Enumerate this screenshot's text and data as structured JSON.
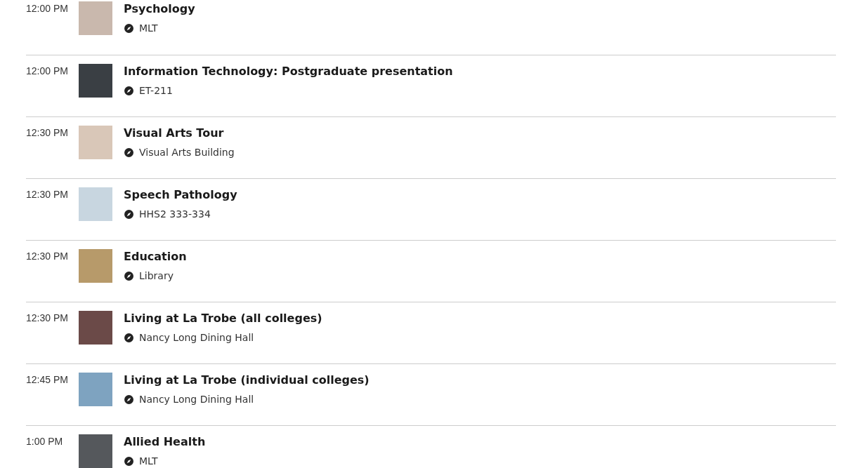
{
  "events": [
    {
      "time": "12:00 PM",
      "title": "Psychology",
      "location": "MLT"
    },
    {
      "time": "12:00 PM",
      "title": "Information Technology: Postgraduate presentation",
      "location": "ET-211"
    },
    {
      "time": "12:30 PM",
      "title": "Visual Arts Tour",
      "location": "Visual Arts Building"
    },
    {
      "time": "12:30 PM",
      "title": "Speech Pathology",
      "location": "HHS2 333-334"
    },
    {
      "time": "12:30 PM",
      "title": "Education",
      "location": "Library"
    },
    {
      "time": "12:30 PM",
      "title": "Living at La Trobe (all colleges)",
      "location": "Nancy Long Dining Hall"
    },
    {
      "time": "12:45 PM",
      "title": "Living at La Trobe (individual colleges)",
      "location": "Nancy Long Dining Hall"
    },
    {
      "time": "1:00 PM",
      "title": "Allied Health",
      "location": "MLT"
    }
  ]
}
